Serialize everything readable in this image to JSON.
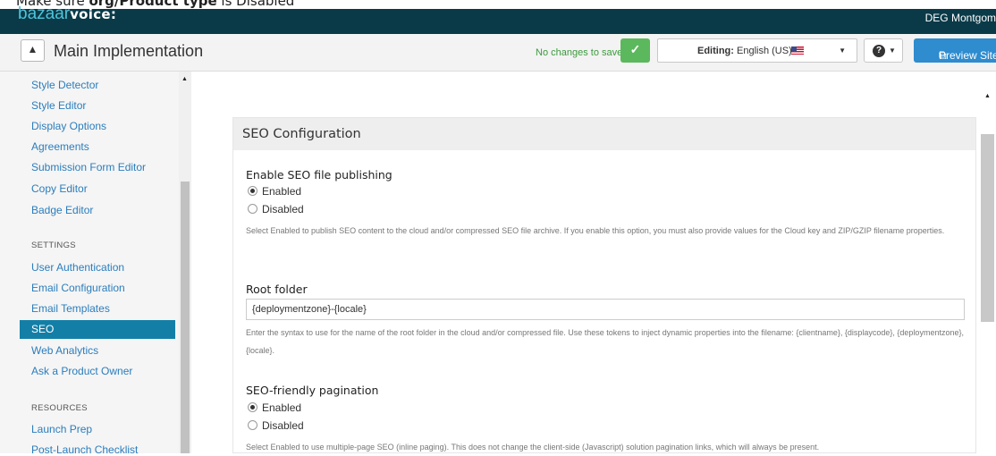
{
  "instruction": {
    "prefix": "Make sure ",
    "bold": "org/Product type",
    "suffix": " is Disabled"
  },
  "topbar": {
    "brand_a": "bazaar",
    "brand_b": "voice:",
    "user": "DEG Montgom"
  },
  "header": {
    "home_icon": "home-icon",
    "title": "Main Implementation",
    "save_status": "No changes to save",
    "save_icon": "check-icon",
    "locale_prefix": "Editing:",
    "locale_value": "English (US)",
    "help_icon": "question-icon",
    "preview_icon": "external-link-icon",
    "preview_label": "Preview Site"
  },
  "sidebar": {
    "items_top": [
      "Style Detector",
      "Style Editor",
      "Display Options",
      "Agreements",
      "Submission Form Editor",
      "Copy Editor",
      "Badge Editor"
    ],
    "settings_heading": "SETTINGS",
    "settings_items": [
      "User Authentication",
      "Email Configuration",
      "Email Templates",
      "SEO",
      "Web Analytics",
      "Ask a Product Owner"
    ],
    "active_item": "SEO",
    "resources_heading": "RESOURCES",
    "resources_items": [
      "Launch Prep",
      "Post-Launch Checklist"
    ]
  },
  "panel": {
    "title": "SEO Configuration",
    "seo_publishing": {
      "label": "Enable SEO file publishing",
      "options": [
        "Enabled",
        "Disabled"
      ],
      "selected": "Enabled",
      "help": "Select Enabled to publish SEO content to the cloud and/or compressed SEO file archive. If you enable this option, you must also provide values for the Cloud key and ZIP/GZIP filename properties."
    },
    "root_folder": {
      "label": "Root folder",
      "value": "{deploymentzone}-{locale}",
      "help": "Enter the syntax to use for the name of the root folder in the cloud and/or compressed file. Use these tokens to inject dynamic properties into the filename: {clientname}, {displaycode}, {deploymentzone}, {locale}."
    },
    "pagination": {
      "label": "SEO-friendly pagination",
      "options": [
        "Enabled",
        "Disabled"
      ],
      "selected": "Enabled",
      "help": "Select Enabled to use multiple-page SEO (inline paging). This does not change the client-side (Javascript) solution pagination links, which will always be present."
    }
  },
  "colors": {
    "topbar": "#0a3a48",
    "link": "#2b7dbc",
    "active": "#137fa7",
    "save": "#5cb85c",
    "preview": "#2e8ccf"
  }
}
